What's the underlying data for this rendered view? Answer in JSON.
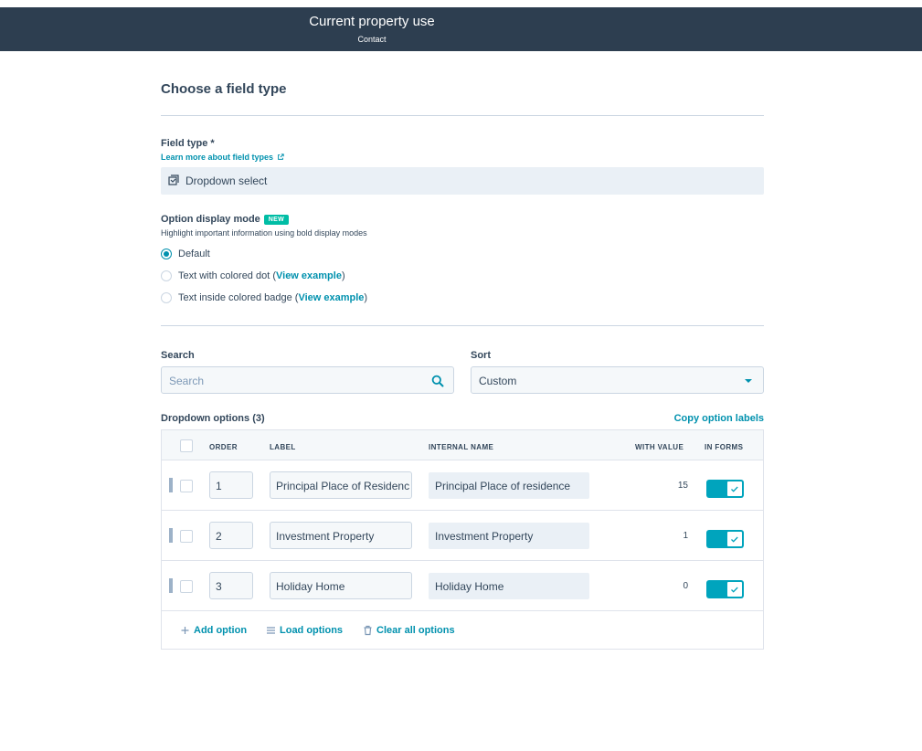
{
  "header": {
    "title": "Current property use",
    "subtitle": "Contact"
  },
  "section": {
    "title": "Choose a field type"
  },
  "field_type": {
    "label": "Field type *",
    "learn_more": "Learn more about field types",
    "value": "Dropdown select"
  },
  "display_mode": {
    "label": "Option display mode",
    "badge": "NEW",
    "description": "Highlight important information using bold display modes",
    "options": [
      {
        "label": "Default",
        "selected": true
      },
      {
        "label": "Text with colored dot (",
        "link": "View example",
        "suffix": ")",
        "selected": false
      },
      {
        "label": "Text inside colored badge (",
        "link": "View example",
        "suffix": ")",
        "selected": false
      }
    ]
  },
  "search": {
    "label": "Search",
    "placeholder": "Search"
  },
  "sort": {
    "label": "Sort",
    "value": "Custom"
  },
  "options_table": {
    "title": "Dropdown options (3)",
    "copy_labels": "Copy option labels",
    "columns": {
      "order": "ORDER",
      "label": "LABEL",
      "internal_name": "INTERNAL NAME",
      "with_value": "WITH VALUE",
      "in_forms": "IN FORMS"
    },
    "rows": [
      {
        "order": "1",
        "label": "Principal Place of Residence",
        "internal_name": "Principal Place of residence",
        "with_value": "15",
        "in_forms": true
      },
      {
        "order": "2",
        "label": "Investment Property",
        "internal_name": "Investment Property",
        "with_value": "1",
        "in_forms": true
      },
      {
        "order": "3",
        "label": "Holiday Home",
        "internal_name": "Holiday Home",
        "with_value": "0",
        "in_forms": true
      }
    ],
    "footer": {
      "add": "Add option",
      "load": "Load options",
      "clear": "Clear all options"
    }
  },
  "colors": {
    "header_bg": "#2d3e50",
    "accent": "#0091ae",
    "toggle": "#00a4bd",
    "badge": "#00bda5"
  }
}
